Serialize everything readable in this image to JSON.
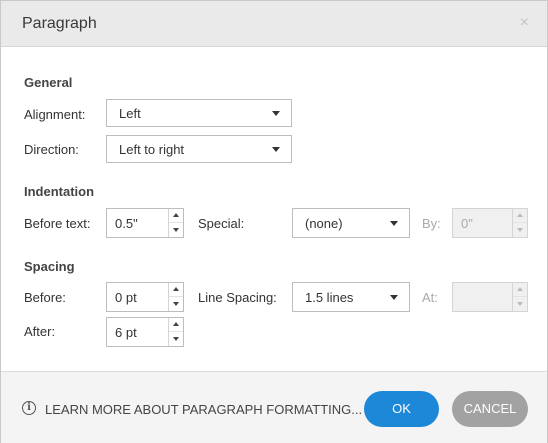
{
  "dialog": {
    "title": "Paragraph",
    "close_glyph": "×"
  },
  "general": {
    "heading": "General",
    "alignment": {
      "label": "Alignment:",
      "value": "Left"
    },
    "direction": {
      "label": "Direction:",
      "value": "Left to right"
    }
  },
  "indentation": {
    "heading": "Indentation",
    "before_text": {
      "label": "Before text:",
      "value": "0.5\""
    },
    "special": {
      "label": "Special:",
      "value": "(none)"
    },
    "by": {
      "label": "By:",
      "value": "0\""
    }
  },
  "spacing": {
    "heading": "Spacing",
    "before": {
      "label": "Before:",
      "value": "0 pt"
    },
    "after": {
      "label": "After:",
      "value": "6 pt"
    },
    "line_spacing": {
      "label": "Line Spacing:",
      "value": "1.5 lines"
    },
    "at": {
      "label": "At:",
      "value": ""
    }
  },
  "footer": {
    "info_glyph": "i",
    "learn_more": "LEARN MORE ABOUT PARAGRAPH FORMATTING...",
    "ok_label": "OK",
    "cancel_label": "CANCEL"
  },
  "colors": {
    "primary": "#1d87d8",
    "secondary": "#a2a2a2"
  },
  "icons": [
    "close-icon",
    "dropdown-arrow-icon",
    "spin-up-icon",
    "spin-down-icon",
    "info-icon"
  ]
}
